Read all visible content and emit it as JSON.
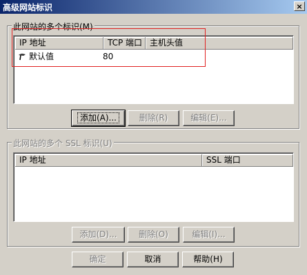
{
  "window": {
    "title": "高级网站标识",
    "close_glyph": "×"
  },
  "group1": {
    "legend": "此网站的多个标识(M)",
    "columns": [
      "IP 地址",
      "TCP 端口",
      "主机头值"
    ],
    "rows": [
      {
        "ip": "默认值",
        "port": "80",
        "host": ""
      }
    ],
    "buttons": {
      "add": "添加(A)...",
      "remove": "删除(R)",
      "edit": "编辑(E)..."
    }
  },
  "group2": {
    "legend": "此网站的多个 SSL 标识(U)",
    "columns": [
      "IP 地址",
      "SSL 端口"
    ],
    "rows": [],
    "buttons": {
      "add": "添加(D)...",
      "remove": "删除(O)",
      "edit": "编辑(I)..."
    }
  },
  "footer": {
    "ok": "确定",
    "cancel": "取消",
    "help": "帮助(H)"
  },
  "colors": {
    "title_gradient_start": "#0a246a",
    "title_gradient_end": "#a6caf0",
    "face": "#d4d0c8",
    "annotation": "#e02020"
  },
  "icons": {
    "row": "website-icon"
  }
}
